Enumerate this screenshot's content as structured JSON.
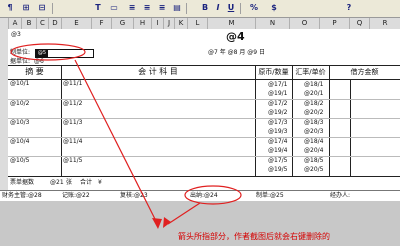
{
  "toolbar": {
    "buttons": [
      "¶",
      "⊞",
      "⊟",
      "T",
      "▭",
      "▤",
      "B",
      "I",
      "U",
      "%",
      "$",
      "?"
    ]
  },
  "columns": [
    "A",
    "B",
    "C",
    "D",
    "E",
    "F",
    "G",
    "H",
    "I",
    "J",
    "K",
    "L",
    "M",
    "N",
    "O",
    "P",
    "Q",
    "R"
  ],
  "sheet": {
    "cell_ref": "@3",
    "title": "@4",
    "unit_label": "制单位:",
    "unit_value": "@5",
    "sub_label": "据单位:",
    "sub_value": "@6",
    "date_text": "@7 年 @8 月 @9 日",
    "headers": {
      "summary": "摘  要",
      "account": "会 计 科 目",
      "qty": "原币/数量",
      "rate": "汇率/单价",
      "amount": "借方金额"
    },
    "rows": [
      {
        "summary": "@10/1",
        "account": "@11/1",
        "qty1": "@17/1",
        "qty2": "@19/1",
        "rate1": "@18/1",
        "rate2": "@20/1"
      },
      {
        "summary": "@10/2",
        "account": "@11/2",
        "qty1": "@17/2",
        "qty2": "@19/2",
        "rate1": "@18/2",
        "rate2": "@20/2"
      },
      {
        "summary": "@10/3",
        "account": "@11/3",
        "qty1": "@17/3",
        "qty2": "@19/3",
        "rate1": "@18/3",
        "rate2": "@20/3"
      },
      {
        "summary": "@10/4",
        "account": "@11/4",
        "qty1": "@17/4",
        "qty2": "@19/4",
        "rate1": "@18/4",
        "rate2": "@20/4"
      },
      {
        "summary": "@10/5",
        "account": "@11/5",
        "qty1": "@17/5",
        "qty2": "@19/5",
        "rate1": "@18/5",
        "rate2": "@20/5"
      }
    ],
    "total_row": {
      "label": "票单据数",
      "count": "@21",
      "unit": "张",
      "total_label": "合计",
      "total_value": "¥"
    }
  },
  "footer": {
    "items": [
      "财务主管:@28",
      "记账:@22",
      "复核:@23",
      "出纳:@24",
      "制单:@25",
      "经办人:"
    ]
  },
  "annotation": {
    "note": "箭头所指部分，作者截图后就会右键删除的",
    "color": "#d50000"
  }
}
